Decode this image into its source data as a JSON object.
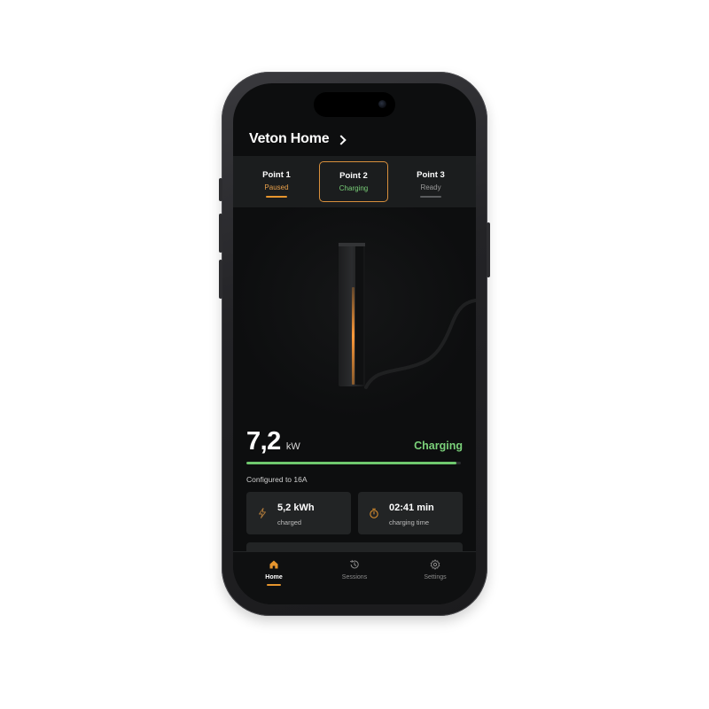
{
  "header": {
    "site_name": "Veton Home",
    "chevron_icon": "chevron-right-icon"
  },
  "points": [
    {
      "name": "Point 1",
      "status": "Paused",
      "status_color": "#e8a04a",
      "underline_color": "#e6952e",
      "selected": false
    },
    {
      "name": "Point 2",
      "status": "Charging",
      "status_color": "#79cf78",
      "underline_color": "",
      "selected": true
    },
    {
      "name": "Point 3",
      "status": "Ready",
      "status_color": "#9a9a9a",
      "underline_color": "#5a5c5e",
      "selected": false
    }
  ],
  "session": {
    "power_value": "7,2",
    "power_unit": "kW",
    "status": "Charging",
    "progress_fraction": 0.98,
    "config": "Configured to 16A"
  },
  "stats": [
    {
      "icon": "lightning-icon",
      "value": "5,2 kWh",
      "label": "charged"
    },
    {
      "icon": "timer-icon",
      "value": "02:41 min",
      "label": "charging time"
    }
  ],
  "tabbar": {
    "tabs": [
      {
        "icon": "home-icon",
        "label": "Home",
        "active": true
      },
      {
        "icon": "history-icon",
        "label": "Sessions",
        "active": false
      },
      {
        "icon": "gear-icon",
        "label": "Settings",
        "active": false
      }
    ]
  },
  "colors": {
    "accent": "#e6952e",
    "charging_green": "#6fc86e",
    "background": "#0d0e0f",
    "card": "#222425"
  }
}
